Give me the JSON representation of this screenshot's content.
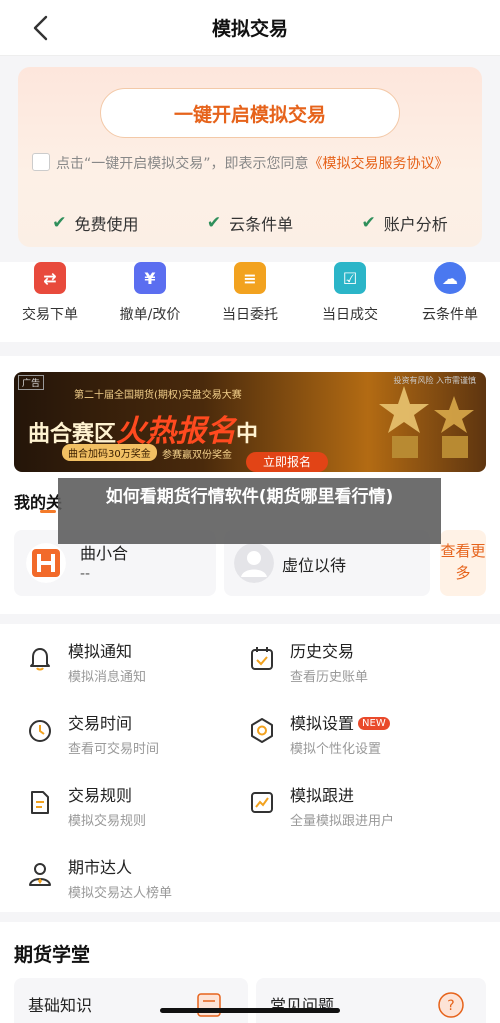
{
  "nav": {
    "title": "模拟交易"
  },
  "hero": {
    "cta_label": "一键开启模拟交易",
    "agree_prefix": "点击“一键开启模拟交易”，即表示您同意",
    "agree_link": "《模拟交易服务协议》",
    "features": [
      "免费使用",
      "云条件单",
      "账户分析"
    ]
  },
  "quick": [
    {
      "label": "交易下单",
      "icon": "trade-order-icon",
      "color": "#e84a3c"
    },
    {
      "label": "撤单/改价",
      "icon": "cancel-order-icon",
      "color": "#5b6ef0"
    },
    {
      "label": "当日委托",
      "icon": "daily-entrust-icon",
      "color": "#f2a21f"
    },
    {
      "label": "当日成交",
      "icon": "daily-deal-icon",
      "color": "#2bb5c8"
    },
    {
      "label": "云条件单",
      "icon": "cloud-order-icon",
      "color": "#4a78f0"
    }
  ],
  "banner": {
    "ad_tag": "广告",
    "small_title": "第二十届全国期货(期权)实盘交易大赛",
    "zone": "曲合赛区",
    "hot": "火热报名",
    "suffix": "中",
    "tag1": "曲合加码30万奖金",
    "tag2": "参赛赢双份奖金",
    "button": "立即报名",
    "risk": "投资有风险 入市需谨慎"
  },
  "my_team": {
    "label": "我的关",
    "overlay": "如何看期货行情软件(期货哪里看行情)",
    "member1_name": "曲小合",
    "member1_value": "--",
    "member2_name": "虚位以待",
    "see_more": "查看更多"
  },
  "list": [
    {
      "title": "模拟通知",
      "sub": "模拟消息通知",
      "icon": "bell-icon"
    },
    {
      "title": "历史交易",
      "sub": "查看历史账单",
      "icon": "calendar-check-icon"
    },
    {
      "title": "交易时间",
      "sub": "查看可交易时间",
      "icon": "clock-icon"
    },
    {
      "title": "模拟设置",
      "sub": "模拟个性化设置",
      "icon": "settings-icon",
      "badge": "NEW"
    },
    {
      "title": "交易规则",
      "sub": "模拟交易规则",
      "icon": "document-icon"
    },
    {
      "title": "模拟跟进",
      "sub": "全量模拟跟进用户",
      "icon": "chart-up-icon"
    },
    {
      "title": "期市达人",
      "sub": "模拟交易达人榜单",
      "icon": "expert-icon"
    }
  ],
  "school": {
    "title": "期货学堂",
    "cards": [
      "基础知识",
      "常见问题"
    ]
  }
}
